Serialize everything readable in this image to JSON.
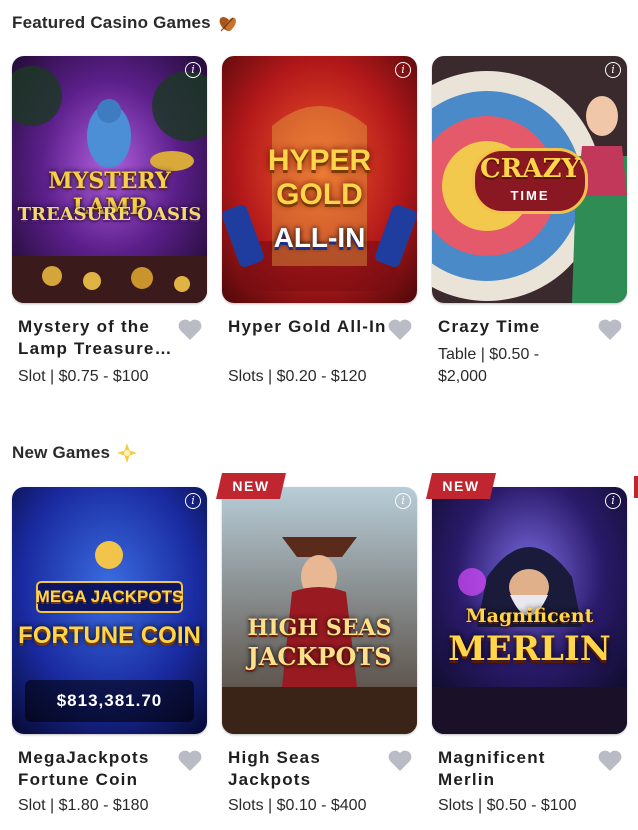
{
  "sections": [
    {
      "title": "Featured Casino Games",
      "icon": "leaves-icon",
      "games": [
        {
          "name": "Mystery of the Lamp Treasure Oasis",
          "meta": "Slot | $0.75 - $100",
          "art_title": "MYSTERY LAMP",
          "art_sub": "TREASURE OASIS"
        },
        {
          "name": "Hyper Gold All-In",
          "meta": "Slots | $0.20 - $120",
          "art_title": "HYPER GOLD",
          "art_sub": "ALL-IN"
        },
        {
          "name": "Crazy Time",
          "meta": "Table | $0.50 - $2,000",
          "art_title": "CRAZY",
          "art_sub": "TIME"
        }
      ]
    },
    {
      "title": "New Games",
      "icon": "sparkle-star-icon",
      "games": [
        {
          "name": "MegaJackpots Fortune Coin",
          "meta": "Slot | $1.80 - $180",
          "jackpot": "$813,381.70",
          "art_title": "MEGA JACKPOTS",
          "art_sub": "FORTUNE COIN"
        },
        {
          "name": "High Seas Jackpots",
          "meta": "Slots | $0.10 - $400",
          "badge": "NEW",
          "art_title": "HIGH SEAS",
          "art_sub": "JACKPOTS"
        },
        {
          "name": "Magnificent Merlin",
          "meta": "Slots | $0.50 - $100",
          "badge": "NEW",
          "art_title": "Magnificent",
          "art_sub": "MERLIN"
        }
      ]
    }
  ],
  "colors": {
    "badge": "#c0262f",
    "heart": "#b9bcc4",
    "text": "#1f1f1f"
  }
}
